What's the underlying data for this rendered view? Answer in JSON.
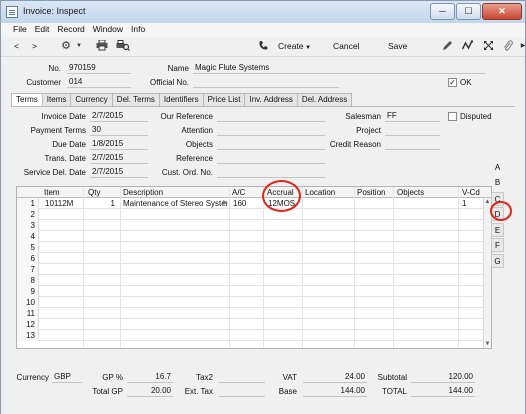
{
  "window": {
    "title": "Invoice: Inspect",
    "buttons": {
      "minimize": "─",
      "maximize": "☐",
      "close": "✕"
    }
  },
  "menu": [
    "File",
    "Edit",
    "Record",
    "Window",
    "Info"
  ],
  "toolbar": {
    "back": "<",
    "forward": ">",
    "create": "Create",
    "cancel": "Cancel",
    "save": "Save"
  },
  "header": {
    "no_label": "No.",
    "no_value": "970159",
    "name_label": "Name",
    "name_value": "Magic Flute Systems",
    "customer_label": "Customer",
    "customer_value": "014",
    "official_label": "Official No.",
    "official_value": "",
    "ok_label": "OK",
    "ok_checked": true
  },
  "tabs": [
    "Terms",
    "Items",
    "Currency",
    "Del. Terms",
    "Identifiers",
    "Price List",
    "Inv. Address",
    "Del. Address"
  ],
  "terms": {
    "invoice_date_label": "Invoice Date",
    "invoice_date": "2/7/2015",
    "payment_terms_label": "Payment Terms",
    "payment_terms": "30",
    "due_date_label": "Due Date",
    "due_date": "1/8/2015",
    "trans_date_label": "Trans. Date",
    "trans_date": "2/7/2015",
    "service_del_date_label": "Service Del. Date",
    "service_del_date": "2/7/2015",
    "our_reference_label": "Our Reference",
    "our_reference": "",
    "attention_label": "Attention",
    "attention": "",
    "objects_label": "Objects",
    "objects": "",
    "reference_label": "Reference",
    "reference": "",
    "cust_ord_no_label": "Cust. Ord. No.",
    "cust_ord_no": "",
    "salesman_label": "Salesman",
    "salesman": "FF",
    "project_label": "Project",
    "project": "",
    "credit_reason_label": "Credit Reason",
    "credit_reason": "",
    "disputed_label": "Disputed",
    "disputed_checked": false
  },
  "grid": {
    "columns": [
      "Item",
      "Qty",
      "Description",
      "A/C",
      "Accrual",
      "Location",
      "Position",
      "Objects",
      "V-Cd"
    ],
    "rows": [
      {
        "num": "1",
        "item": "10112M",
        "qty": "1",
        "description": "Maintenance of Stereo System",
        "ac": "160",
        "accrual": "12MOS",
        "location": "",
        "position": "",
        "objects": "",
        "vcd": "1"
      },
      {
        "num": "2"
      },
      {
        "num": "3"
      },
      {
        "num": "4"
      },
      {
        "num": "5"
      },
      {
        "num": "6"
      },
      {
        "num": "7"
      },
      {
        "num": "8"
      },
      {
        "num": "9"
      },
      {
        "num": "10"
      },
      {
        "num": "11"
      },
      {
        "num": "12"
      },
      {
        "num": "13"
      }
    ],
    "flags": [
      "A",
      "B",
      "C",
      "D",
      "E",
      "F",
      "G"
    ],
    "selected_flag": "B"
  },
  "footer": {
    "currency_label": "Currency",
    "currency": "GBP",
    "gp_pct_label": "GP %",
    "gp_pct": "16.7",
    "total_gp_label": "Total GP",
    "total_gp": "20.00",
    "tax2_label": "Tax2",
    "tax2": "",
    "ext_tax_label": "Ext. Tax",
    "ext_tax": "",
    "vat_label": "VAT",
    "vat": "24.00",
    "base_label": "Base",
    "base": "144.00",
    "subtotal_label": "Subtotal",
    "subtotal": "120.00",
    "total_label": "TOTAL",
    "total": "144.00"
  },
  "colors": {
    "highlight_ring": "#e0251b",
    "title_bar": "#c3d5ec"
  }
}
